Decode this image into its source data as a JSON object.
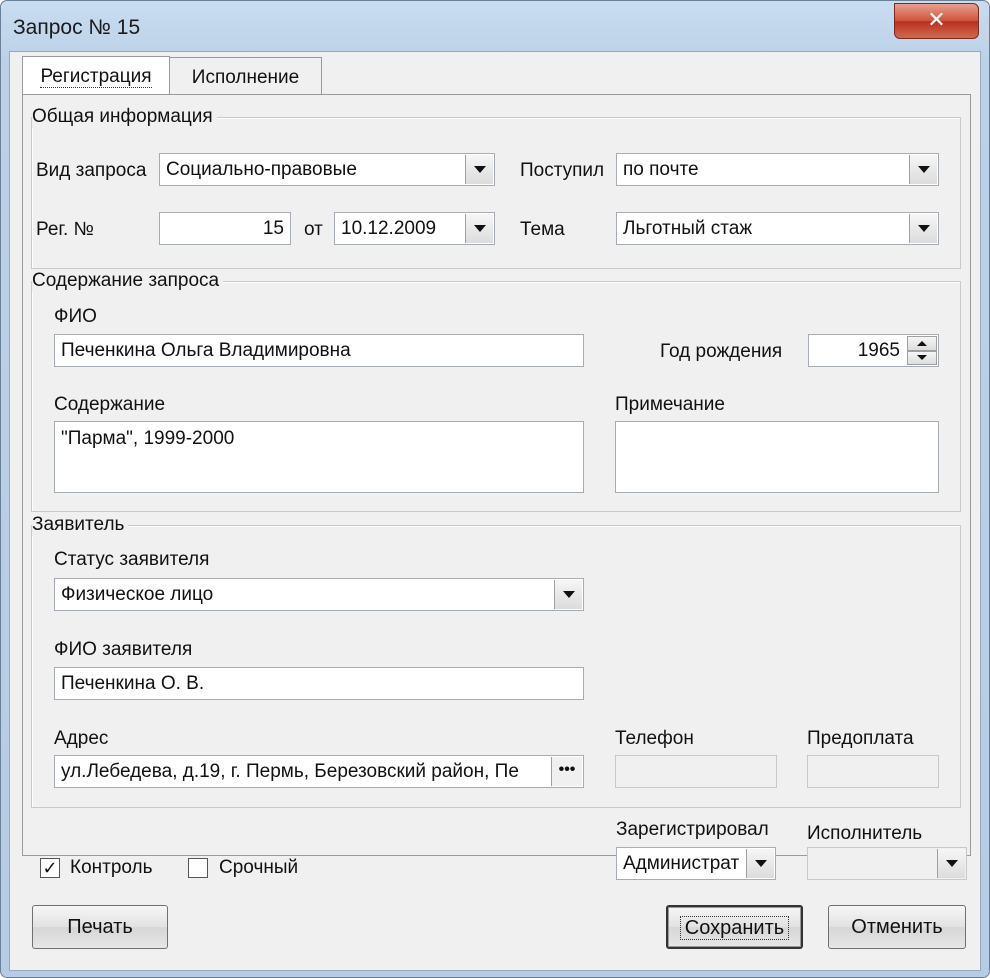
{
  "window": {
    "title": "Запрос № 15",
    "close_symbol": "✕"
  },
  "tabs": [
    {
      "label": "Регистрация",
      "active": true
    },
    {
      "label": "Исполнение",
      "active": false
    }
  ],
  "general": {
    "legend": "Общая информация",
    "request_type": {
      "label": "Вид запроса",
      "value": "Социально-правовые"
    },
    "received": {
      "label": "Поступил",
      "value": "по почте"
    },
    "reg_no": {
      "label": "Рег. №",
      "value": "15"
    },
    "date": {
      "label": "от",
      "value": "10.12.2009"
    },
    "topic": {
      "label": "Тема",
      "value": "Льготный стаж"
    }
  },
  "content": {
    "legend": "Содержание запроса",
    "fio": {
      "label": "ФИО",
      "value": "Печенкина Ольга Владимировна"
    },
    "birth_year": {
      "label": "Год рождения",
      "value": "1965"
    },
    "body": {
      "label": "Содержание",
      "value": "\"Парма\", 1999-2000"
    },
    "note": {
      "label": "Примечание",
      "value": ""
    }
  },
  "applicant": {
    "legend": "Заявитель",
    "status": {
      "label": "Статус заявителя",
      "value": "Физическое лицо"
    },
    "fio": {
      "label": "ФИО заявителя",
      "value": "Печенкина О. В."
    },
    "address": {
      "label": "Адрес",
      "value": "ул.Лебедева, д.19, г. Пермь, Березовский район, Пе",
      "button": "•••"
    },
    "phone": {
      "label": "Телефон",
      "value": ""
    },
    "prepaid": {
      "label": "Предоплата",
      "value": ""
    }
  },
  "footer": {
    "registered_by": {
      "label": "Зарегистрировал",
      "value": "Администрат"
    },
    "executor": {
      "label": "Исполнитель",
      "value": ""
    },
    "control": {
      "label": "Контроль",
      "checked": true,
      "mark": "✓"
    },
    "urgent": {
      "label": "Срочный",
      "checked": false,
      "mark": ""
    },
    "print": "Печать",
    "save": "Сохранить",
    "cancel": "Отменить"
  }
}
